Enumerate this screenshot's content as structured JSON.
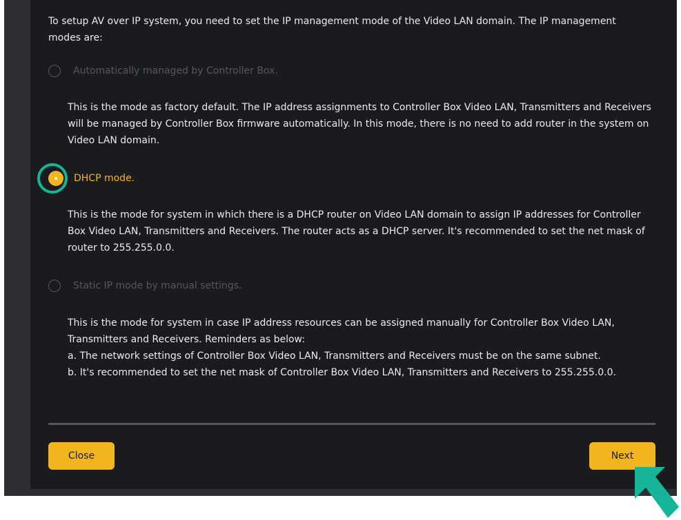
{
  "intro_text": "To setup AV over IP system, you need to set the IP management mode of the Video LAN domain. The IP management modes are:",
  "modes": [
    {
      "label": "Automatically managed by Controller Box.",
      "selected": false,
      "description": "This is the mode as factory default. The IP address assignments to Controller Box Video LAN, Transmitters and Receivers will be managed by Controller Box firmware automatically. In this mode, there is no need to add router in the system on Video LAN domain."
    },
    {
      "label": "DHCP mode.",
      "selected": true,
      "description": "This is the mode for system in which there is a DHCP router on Video LAN domain to assign IP addresses for Controller Box Video LAN, Transmitters and Receivers. The router acts as a DHCP server. It's recommended to set the net mask of router to 255.255.0.0."
    },
    {
      "label": "Static IP mode by manual settings.",
      "selected": false,
      "description_lines": [
        "This is the mode for system in case IP address resources can be assigned manually for Controller Box Video LAN, Transmitters and Receivers. Reminders as below:",
        "a. The network settings of Controller Box Video LAN, Transmitters and Receivers must be on the same subnet.",
        "b. It's recommended to set the net mask of Controller Box Video LAN, Transmitters and Receivers to 255.255.0.0."
      ]
    }
  ],
  "buttons": {
    "close": "Close",
    "next": "Next"
  },
  "colors": {
    "accent": "#f2b51e",
    "panel_bg": "#1a1b1f",
    "text": "#ececec",
    "disabled": "#55575c",
    "highlight": "#16b59a"
  },
  "icons": {
    "highlight_ring": "highlight-ring",
    "cursor": "cursor-arrow-icon"
  }
}
